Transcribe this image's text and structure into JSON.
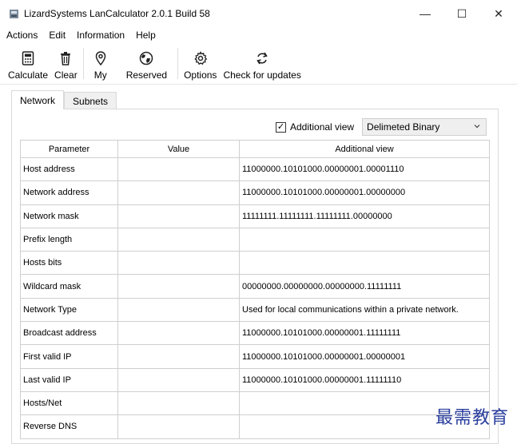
{
  "window": {
    "title": "LizardSystems LanCalculator 2.0.1 Build 58",
    "controls": {
      "minimize": "—",
      "maximize": "☐",
      "close": "✕"
    }
  },
  "menu": [
    "Actions",
    "Edit",
    "Information",
    "Help"
  ],
  "toolbar": {
    "calculate": "Calculate",
    "clear": "Clear",
    "my": "My",
    "reserved": "Reserved",
    "options": "Options",
    "check_updates": "Check for updates"
  },
  "tabs": [
    "Network",
    "Subnets"
  ],
  "additional_view": {
    "label": "Additional view",
    "checked": true,
    "selected": "Delimeted Binary"
  },
  "table": {
    "headers": [
      "Parameter",
      "Value",
      "Additional view"
    ],
    "rows": [
      [
        "Host address",
        "",
        "11000000.10101000.00000001.00001110"
      ],
      [
        "Network address",
        "",
        "11000000.10101000.00000001.00000000"
      ],
      [
        "Network mask",
        "",
        "11111111.11111111.11111111.00000000"
      ],
      [
        "Prefix length",
        "",
        ""
      ],
      [
        "Hosts bits",
        "",
        ""
      ],
      [
        "Wildcard mask",
        "",
        "00000000.00000000.00000000.11111111"
      ],
      [
        "Network Type",
        "",
        "Used for local communications within a private network."
      ],
      [
        "Broadcast address",
        "",
        "11000000.10101000.00000001.11111111"
      ],
      [
        "First valid IP",
        "",
        "11000000.10101000.00000001.00000001"
      ],
      [
        "Last valid IP",
        "",
        "11000000.10101000.00000001.11111110"
      ],
      [
        "Hosts/Net",
        "",
        ""
      ],
      [
        "Reverse DNS",
        "",
        ""
      ]
    ]
  },
  "watermark": "最需教育"
}
